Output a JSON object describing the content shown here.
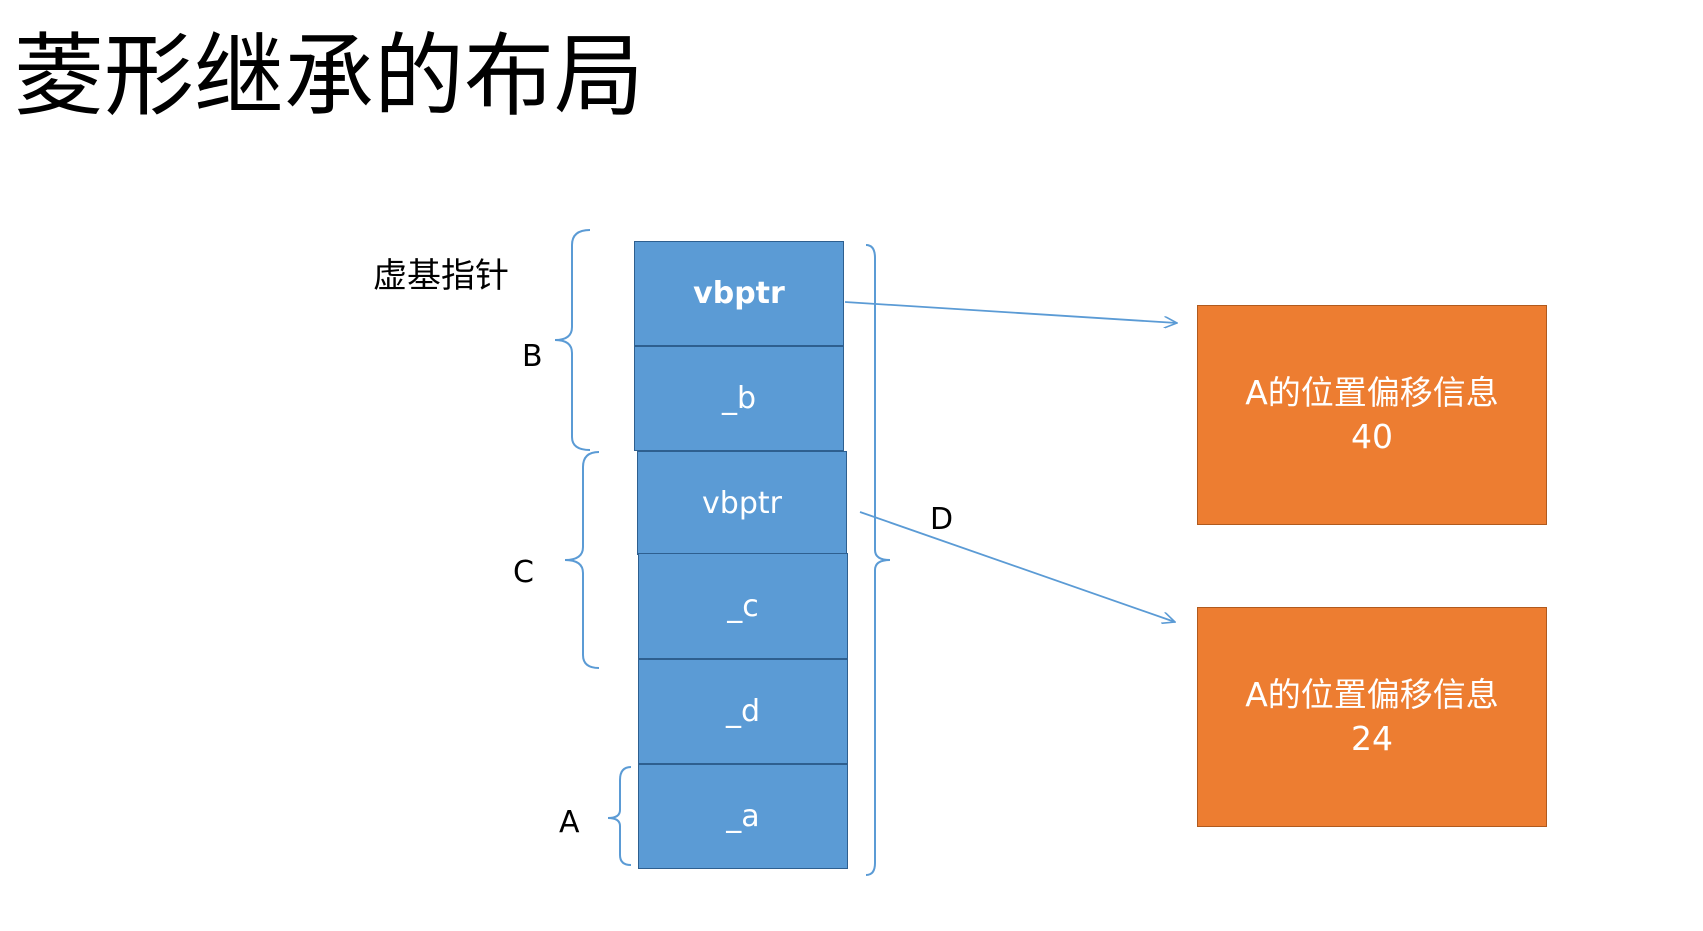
{
  "title": "菱形继承的布局",
  "annotation": "虚基指针",
  "memory_cells": [
    "vbptr",
    "_b",
    "vbptr",
    "_c",
    "_d",
    "_a"
  ],
  "brace_labels": {
    "b": "B",
    "c": "C",
    "a": "A",
    "d": "D"
  },
  "offset_boxes": [
    {
      "text": "A的位置偏移信息",
      "value": "40"
    },
    {
      "text": "A的位置偏移信息",
      "value": "24"
    }
  ],
  "colors": {
    "cell": "#5b9bd5",
    "cell_border": "#2e5f8f",
    "offset_box": "#ed7d31",
    "line": "#5b9bd5"
  }
}
